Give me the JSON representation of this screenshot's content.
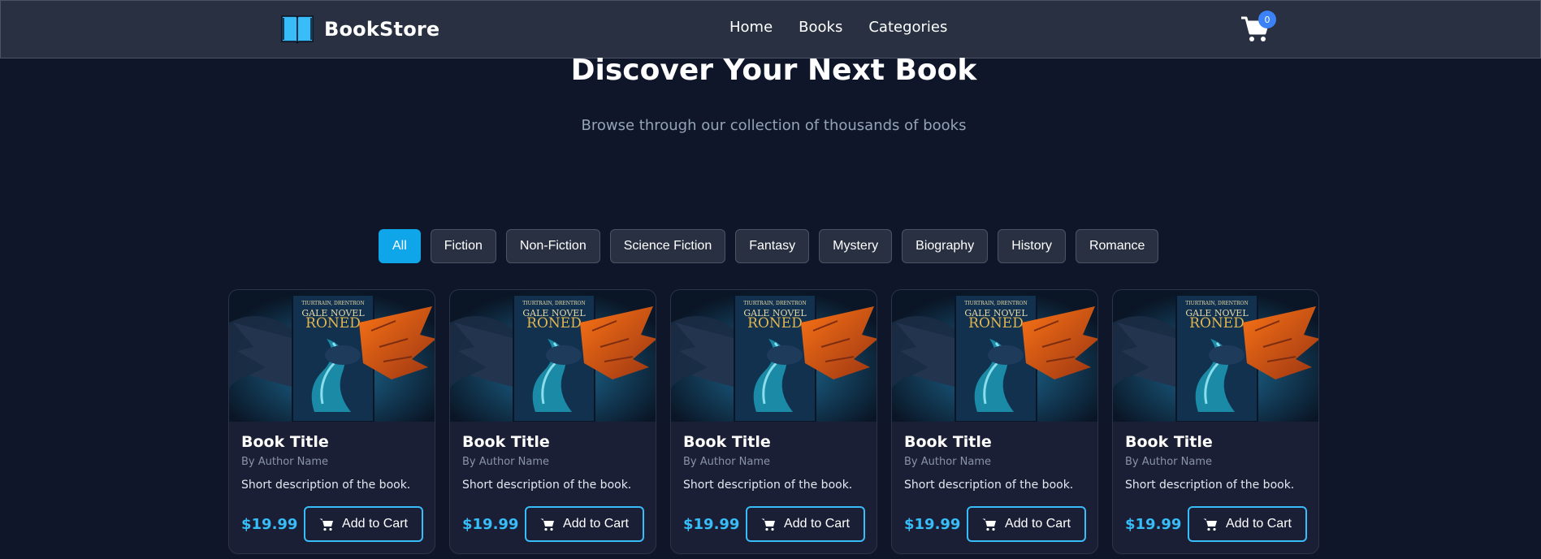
{
  "brand": {
    "name": "BookStore",
    "icon": "open-book-icon"
  },
  "nav": {
    "links": [
      "Home",
      "Books",
      "Categories"
    ]
  },
  "cart": {
    "count": "0",
    "icon": "cart-icon"
  },
  "hero": {
    "title": "Discover Your Next Book",
    "subtitle": "Browse through our collection of thousands of books"
  },
  "filters": {
    "active": "All",
    "items": [
      "All",
      "Fiction",
      "Non-Fiction",
      "Science Fiction",
      "Fantasy",
      "Mystery",
      "Biography",
      "History",
      "Romance"
    ]
  },
  "books": [
    {
      "title": "Book Title",
      "author": "By Author Name",
      "description": "Short description of the book.",
      "price": "$19.99",
      "button": "Add to Cart",
      "cover_text": [
        "TIURTRAIN, DRENTRON",
        "GALE NOVEL",
        "RONED"
      ]
    },
    {
      "title": "Book Title",
      "author": "By Author Name",
      "description": "Short description of the book.",
      "price": "$19.99",
      "button": "Add to Cart",
      "cover_text": [
        "TIURTRAIN, DRENTRON",
        "GALE NOVEL",
        "RONED"
      ]
    },
    {
      "title": "Book Title",
      "author": "By Author Name",
      "description": "Short description of the book.",
      "price": "$19.99",
      "button": "Add to Cart",
      "cover_text": [
        "TIURTRAIN, DRENTRON",
        "GALE NOVEL",
        "RONED"
      ]
    },
    {
      "title": "Book Title",
      "author": "By Author Name",
      "description": "Short description of the book.",
      "price": "$19.99",
      "button": "Add to Cart",
      "cover_text": [
        "TIURTRAIN, DRENTRON",
        "GALE NOVEL",
        "RONED"
      ]
    },
    {
      "title": "Book Title",
      "author": "By Author Name",
      "description": "Short description of the book.",
      "price": "$19.99",
      "button": "Add to Cart",
      "cover_text": [
        "TIURTRAIN, DRENTRON",
        "GALE NOVEL",
        "RONED"
      ]
    }
  ],
  "colors": {
    "background": "#0f1629",
    "navbar": "#283041",
    "accent": "#0ea5e9",
    "price": "#38bdf8",
    "card": "#1a1f35",
    "cart_badge": "#3b82f6"
  }
}
